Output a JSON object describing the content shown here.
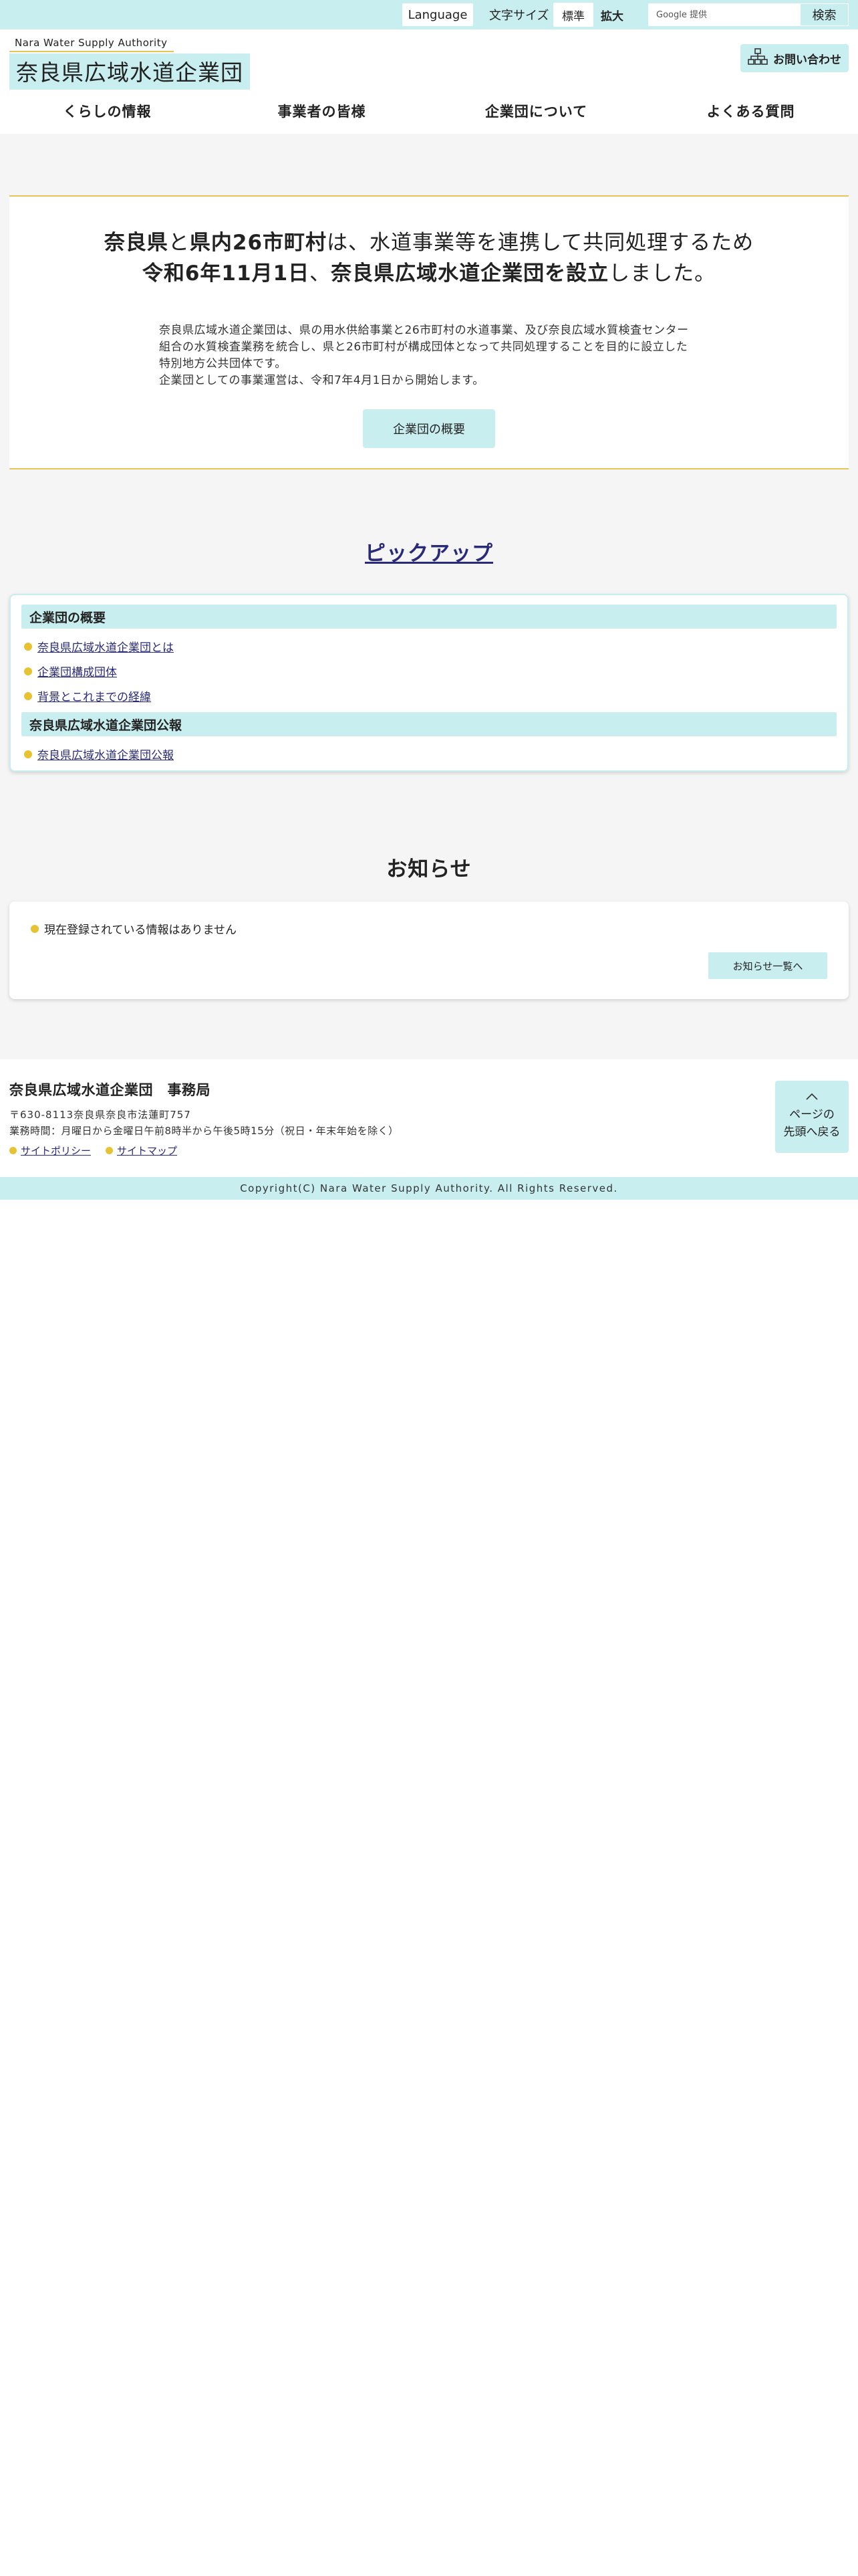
{
  "topbar": {
    "language": "Language",
    "font_size_label": "文字サイズ",
    "font_standard": "標準",
    "font_large": "拡大",
    "search_placeholder": "Google 提供",
    "search_button": "検索"
  },
  "header": {
    "logo_en": "Nara Water Supply Authority",
    "logo_ja": "奈良県広域水道企業団",
    "contact": "お問い合わせ"
  },
  "nav": [
    "くらしの情報",
    "事業者の皆様",
    "企業団について",
    "よくある質問"
  ],
  "hero": {
    "lead1_b1": "奈良県",
    "lead1_t1": "と",
    "lead1_b2": "県内26市町村",
    "lead1_t2": "は、水道事業等を連携して共同処理するため",
    "lead2_b1": "令和6年11月1日",
    "lead2_t1": "、",
    "lead2_b2": "奈良県広域水道企業団を設立",
    "lead2_t2": "しました。",
    "body1": "奈良県広域水道企業団は、県の用水供給事業と26市町村の水道事業、及び奈良広域水質検査センター組合の水質検査業務を統合し、県と26市町村が構成団体となって共同処理することを目的に設立した特別地方公共団体です。",
    "body2": "企業団としての事業運営は、令和7年4月1日から開始します。",
    "button": "企業団の概要"
  },
  "pickup": {
    "title": "ピックアップ",
    "categories": [
      {
        "name": "企業団の概要",
        "links": [
          "奈良県広域水道企業団とは",
          "企業団構成団体",
          "背景とこれまでの経緯"
        ]
      },
      {
        "name": "奈良県広域水道企業団公報",
        "links": [
          "奈良県広域水道企業団公報"
        ]
      }
    ]
  },
  "news": {
    "title": "お知らせ",
    "empty": "現在登録されている情報はありません",
    "more": "お知らせ一覧へ"
  },
  "footer": {
    "title": "奈良県広域水道企業団　事務局",
    "address": "〒630-8113奈良県奈良市法蓮町757",
    "hours": "業務時間：月曜日から金曜日午前8時半から午後5時15分（祝日・年末年始を除く）",
    "links": [
      "サイトポリシー",
      "サイトマップ"
    ],
    "to_top_line1": "ページの",
    "to_top_line2": "先頭へ戻る",
    "copyright": "Copyright(C) Nara Water Supply Authority. All Rights Reserved."
  },
  "colors": {
    "accent": "#c9eef0",
    "gold": "#e7c55a",
    "link": "#2a2a7a"
  }
}
